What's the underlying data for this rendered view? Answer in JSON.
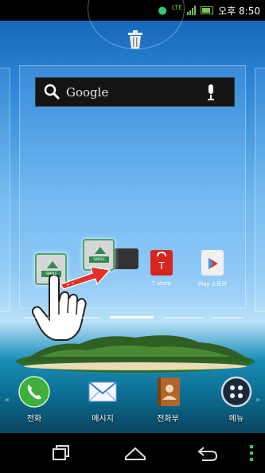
{
  "status_bar": {
    "network": "LTE",
    "time": "오후 8:50",
    "icons": [
      "person-icon",
      "lte-icon",
      "signal-icon",
      "battery-icon"
    ]
  },
  "search": {
    "placeholder": "Google",
    "icons": [
      "search-icon",
      "mic-icon"
    ]
  },
  "home_apps": [
    {
      "name": "simple-home-icon",
      "label": "SIMPLE",
      "state": "source"
    },
    {
      "name": "simple-home-icon",
      "label": "SIMPLE",
      "state": "dragged"
    },
    {
      "name": "t-store-app",
      "label": "T store"
    },
    {
      "name": "play-store-app",
      "label": "Play 스토어"
    }
  ],
  "page_indicator": {
    "pages": 4,
    "active": 2
  },
  "dock": [
    {
      "label": "전화",
      "icon": "phone-icon"
    },
    {
      "label": "메시지",
      "icon": "mail-icon"
    },
    {
      "label": "전화부",
      "icon": "contacts-icon"
    },
    {
      "label": "메뉴",
      "icon": "apps-menu-icon"
    }
  ],
  "nav_buttons": [
    "recent-apps-icon",
    "home-icon",
    "back-icon",
    "menu-icon"
  ],
  "colors": {
    "accent_green": "#7cc24b",
    "drag_arrow": "#e0322b"
  }
}
